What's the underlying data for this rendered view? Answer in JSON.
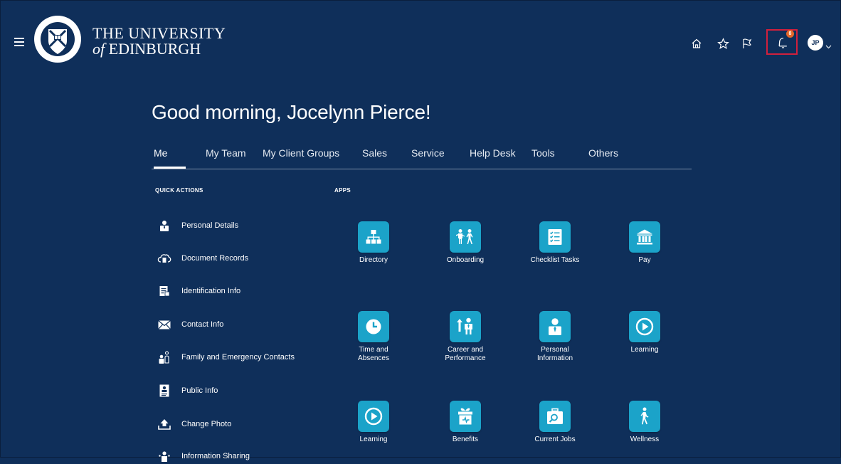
{
  "header": {
    "university_line1": "THE UNIVERSITY",
    "university_of": "of",
    "university_line2": "EDINBURGH",
    "crest_text": "THE UNIVERSITY OF EDINBURGH",
    "notification_count": "8",
    "avatar_initials": "JP",
    "icons": [
      "menu-icon",
      "home-icon",
      "star-icon",
      "flag-icon",
      "notifications-icon",
      "chevron-down-icon"
    ]
  },
  "greeting": "Good morning, Jocelynn Pierce!",
  "tabs": [
    {
      "label": "Me",
      "active": true
    },
    {
      "label": "My Team"
    },
    {
      "label": "My Client Groups"
    },
    {
      "label": "Sales"
    },
    {
      "label": "Service"
    },
    {
      "label": "Help Desk"
    },
    {
      "label": "Tools"
    },
    {
      "label": "Others"
    }
  ],
  "quick_actions": {
    "heading": "QUICK ACTIONS",
    "items": [
      {
        "label": "Personal Details",
        "icon": "person-icon"
      },
      {
        "label": "Document Records",
        "icon": "cloud-document-icon"
      },
      {
        "label": "Identification Info",
        "icon": "id-document-icon"
      },
      {
        "label": "Contact Info",
        "icon": "envelope-icon"
      },
      {
        "label": "Family and Emergency Contacts",
        "icon": "family-icon"
      },
      {
        "label": "Public Info",
        "icon": "badge-icon"
      },
      {
        "label": "Change Photo",
        "icon": "upload-icon"
      },
      {
        "label": "Information Sharing",
        "icon": "share-person-icon"
      }
    ]
  },
  "apps": {
    "heading": "APPS",
    "items": [
      {
        "label": "Directory",
        "icon": "org-chart-icon"
      },
      {
        "label": "Onboarding",
        "icon": "onboarding-icon"
      },
      {
        "label": "Checklist Tasks",
        "icon": "checklist-icon"
      },
      {
        "label": "Pay",
        "icon": "bank-icon"
      },
      {
        "label": "Time and Absences",
        "icon": "clock-icon"
      },
      {
        "label": "Career and Performance",
        "icon": "career-icon"
      },
      {
        "label": "Personal Information",
        "icon": "person-icon"
      },
      {
        "label": "Learning",
        "icon": "play-circle-icon"
      },
      {
        "label": "Learning",
        "icon": "play-circle-icon"
      },
      {
        "label": "Benefits",
        "icon": "gift-icon"
      },
      {
        "label": "Current Jobs",
        "icon": "briefcase-search-icon"
      },
      {
        "label": "Wellness",
        "icon": "walking-person-icon"
      }
    ]
  },
  "colors": {
    "background": "#0f2f5a",
    "tile": "#1ba3c9",
    "highlight_border": "#d2203c",
    "badge": "#e4682a"
  }
}
